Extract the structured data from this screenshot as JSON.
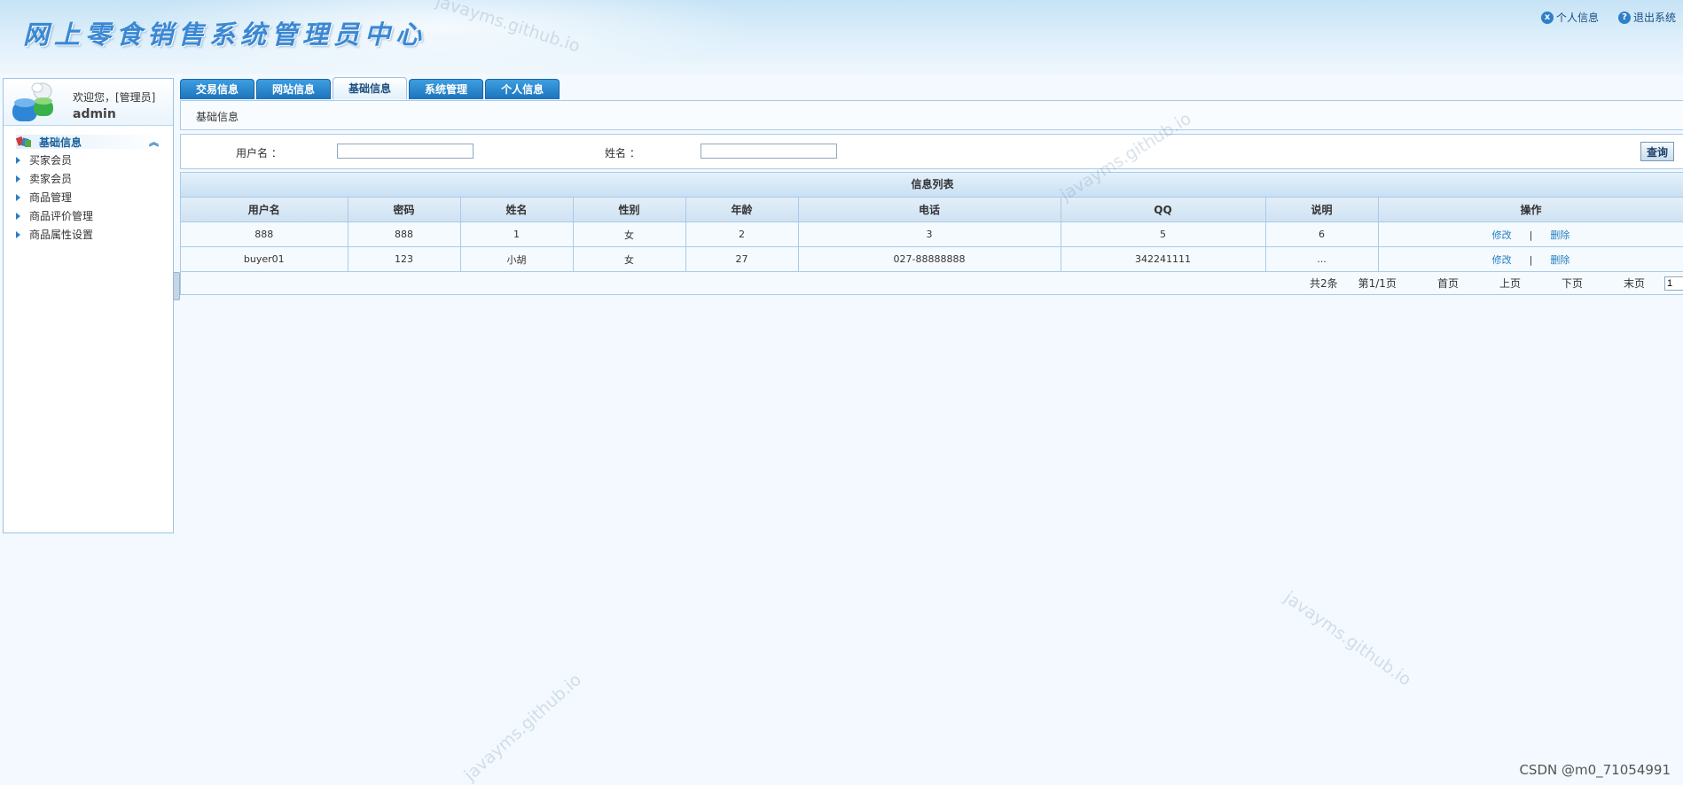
{
  "app": {
    "title": "网上零食销售系统管理员中心"
  },
  "top_links": [
    {
      "icon": "x-icon",
      "label": "个人信息"
    },
    {
      "icon": "help-icon",
      "label": "退出系统"
    }
  ],
  "user": {
    "welcome": "欢迎您，[管理员]",
    "name": "admin"
  },
  "sidebar": {
    "heading": "基础信息",
    "items": [
      {
        "label": "买家会员"
      },
      {
        "label": "卖家会员"
      },
      {
        "label": "商品管理"
      },
      {
        "label": "商品评价管理"
      },
      {
        "label": "商品属性设置"
      }
    ]
  },
  "tabs": [
    {
      "label": "交易信息",
      "active": false
    },
    {
      "label": "网站信息",
      "active": false
    },
    {
      "label": "基础信息",
      "active": true
    },
    {
      "label": "系统管理",
      "active": false
    },
    {
      "label": "个人信息",
      "active": false
    }
  ],
  "breadcrumb": "基础信息",
  "search": {
    "username_label": "用户名  ：",
    "username_value": "",
    "name_label": "姓名  ：",
    "name_value": "",
    "button_label": "查询"
  },
  "table": {
    "title": "信息列表",
    "columns": [
      "用户名",
      "密码",
      "姓名",
      "性别",
      "年龄",
      "电话",
      "QQ",
      "说明",
      "操作"
    ],
    "rows": [
      [
        "888",
        "888",
        "1",
        "女",
        "2",
        "3",
        "5",
        "6"
      ],
      [
        "buyer01",
        "123",
        "小胡",
        "女",
        "27",
        "027-88888888",
        "342241111",
        "..."
      ]
    ],
    "edit_label": "修改",
    "separator": "|",
    "delete_label": "删除"
  },
  "pager": {
    "total": "共2条",
    "page_info": "第1/1页",
    "first": "首页",
    "prev": "上页",
    "next": "下页",
    "last": "末页",
    "page_input": "1"
  },
  "watermarks": {
    "text": "javayms.github.io",
    "corner": "CSDN @m0_71054991"
  },
  "colors": {
    "tab_active_text": "#1a4f80",
    "tab_bg": "#1d73bd",
    "link": "#1f7fbf",
    "title_blue": "#3a88d4"
  }
}
